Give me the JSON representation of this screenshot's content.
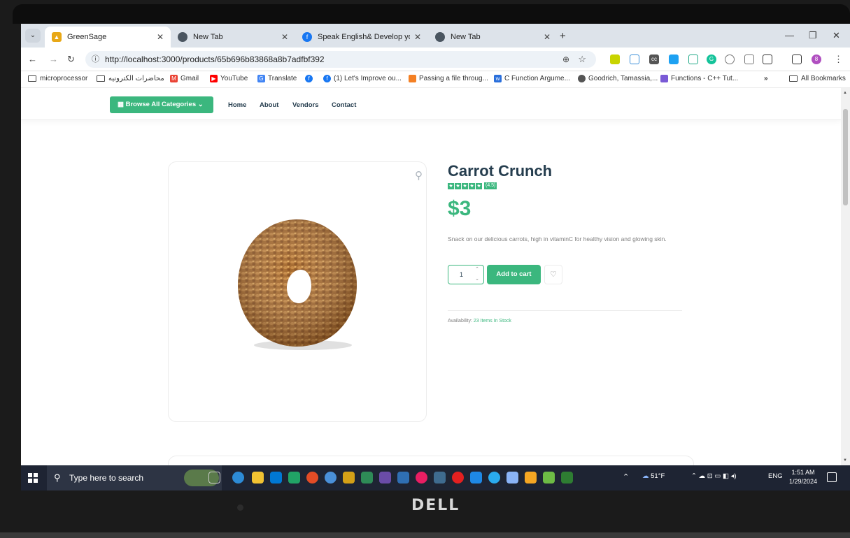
{
  "browser": {
    "tabs": [
      {
        "title": "GreenSage",
        "active": true
      },
      {
        "title": "New Tab",
        "active": false
      },
      {
        "title": "Speak English& Develop your p",
        "active": false
      },
      {
        "title": "New Tab",
        "active": false
      }
    ],
    "url": "http://localhost:3000/products/65b696b83868a8b7adfbf392",
    "bookmarks": [
      "microprocessor",
      "محاضرات الكترونيه",
      "Gmail",
      "YouTube",
      "Translate",
      "(1) Let's Improve ou...",
      "Passing a file throug...",
      "C Function Argume...",
      "Goodrich, Tamassia,...",
      "Functions - C++ Tut...",
      "All Bookmarks"
    ]
  },
  "site": {
    "browse_label": "Browse All Categories",
    "nav": [
      "Home",
      "About",
      "Vendors",
      "Contact"
    ]
  },
  "product": {
    "name": "Carrot Crunch",
    "rating": "(4.5)",
    "rating_value": 4.5,
    "price": "$3",
    "description": "Snack on our delicious carrots, high in vitaminC for healthy vision and glowing skin.",
    "quantity": "1",
    "add_to_cart": "Add to cart",
    "availability_label": "Availability:",
    "availability_value": "23 Items In Stock"
  },
  "taskbar": {
    "search_placeholder": "Type here to search",
    "weather": "51°F",
    "language": "ENG",
    "time": "1:51 AM",
    "date": "1/29/2024"
  },
  "device": {
    "brand": "DELL"
  },
  "colors": {
    "brand_green": "#3bb77e",
    "heading": "#253d4e"
  }
}
